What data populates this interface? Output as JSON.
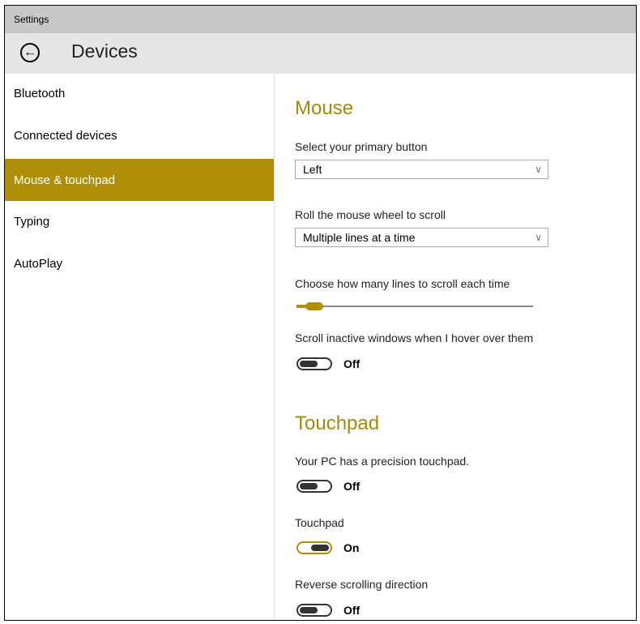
{
  "window": {
    "title": "Settings"
  },
  "header": {
    "title": "Devices",
    "back_icon": "back-arrow-icon"
  },
  "sidebar": {
    "items": [
      {
        "label": "Bluetooth",
        "selected": false
      },
      {
        "label": "Connected devices",
        "selected": false
      },
      {
        "label": "Mouse & touchpad",
        "selected": true
      },
      {
        "label": "Typing",
        "selected": false
      },
      {
        "label": "AutoPlay",
        "selected": false
      }
    ]
  },
  "accent_color": "#b08f08",
  "mouse": {
    "heading": "Mouse",
    "primary_button": {
      "label": "Select your primary button",
      "value": "Left"
    },
    "wheel_scroll": {
      "label": "Roll the mouse wheel to scroll",
      "value": "Multiple lines at a time"
    },
    "lines_slider": {
      "label": "Choose how many lines to scroll each time",
      "value": 3,
      "min": 1,
      "max": 100
    },
    "scroll_inactive": {
      "label": "Scroll inactive windows when I hover over them",
      "state": "Off"
    }
  },
  "touchpad": {
    "heading": "Touchpad",
    "precision": {
      "label": "Your PC has a precision touchpad.",
      "state": "Off"
    },
    "touchpad": {
      "label": "Touchpad",
      "state": "On"
    },
    "reverse": {
      "label": "Reverse scrolling direction",
      "state": "Off"
    }
  }
}
